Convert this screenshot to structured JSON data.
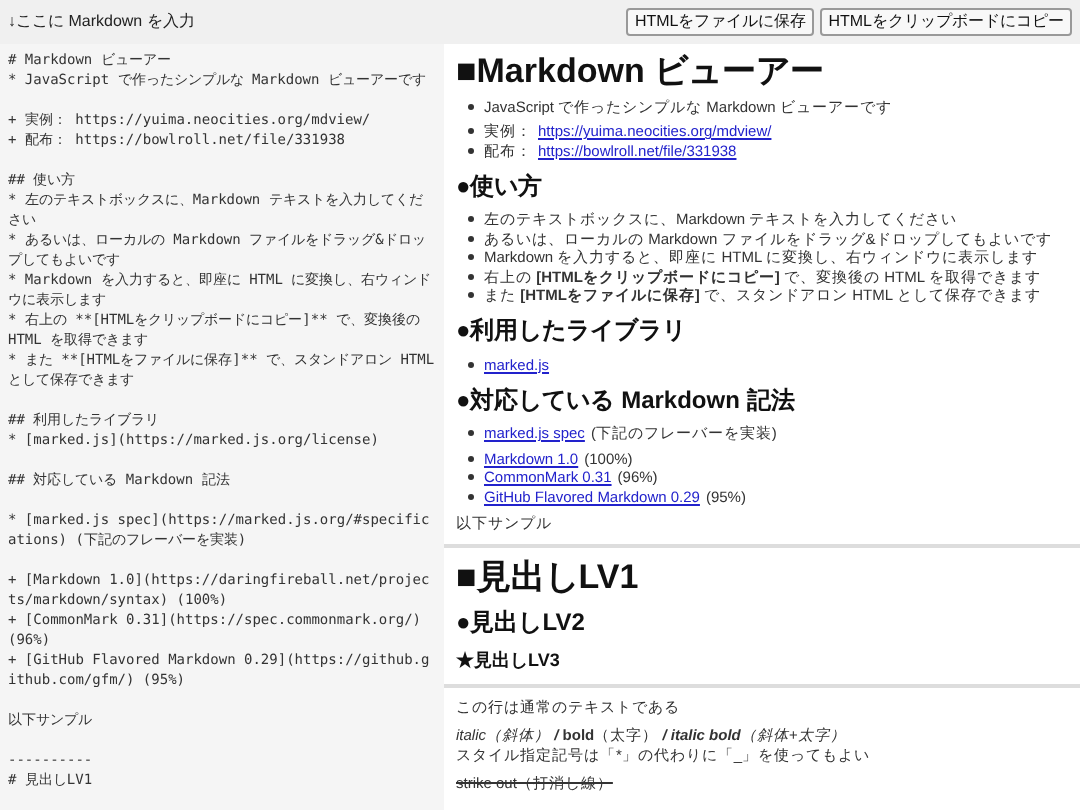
{
  "toolbar": {
    "label": "↓ここに Markdown を入力",
    "buttons": [
      "HTMLをファイルに保存",
      "HTMLをクリップボードにコピー"
    ]
  },
  "editor": {
    "blocks": [
      [
        "# Markdown ビューアー",
        "* JavaScript で作ったシンプルな Markdown ビューアーです"
      ],
      [
        "+ 実例： https://yuima.neocities.org/mdview/",
        "+ 配布： https://bowlroll.net/file/331938"
      ],
      [
        "## 使い方",
        "* 左のテキストボックスに、Markdown テキストを入力してください",
        "* あるいは、ローカルの Markdown ファイルをドラッグ&ドロップしてもよいです",
        "* Markdown を入力すると、即座に HTML に変換し、右ウィンドウに表示します",
        "* 右上の **[HTMLをクリップボードにコピー]** で、変換後の HTML を取得できます",
        "* また **[HTMLをファイルに保存]** で、スタンドアロン HTML として保存できます"
      ],
      [
        "## 利用したライブラリ",
        "* [marked.js](https://marked.js.org/license)"
      ],
      [
        "## 対応している Markdown 記法"
      ],
      [
        "* [marked.js spec](https://marked.js.org/#specifications) (下記のフレーバーを実装)"
      ],
      [
        "+ [Markdown 1.0](https://daringfireball.net/projects/markdown/syntax) (100%)",
        "+ [CommonMark 0.31](https://spec.commonmark.org/) (96%)",
        "+ [GitHub Flavored Markdown 0.29](https://github.github.com/gfm/) (95%)"
      ],
      [
        "以下サンプル"
      ],
      [
        "----------",
        "# 見出しLV1"
      ]
    ]
  },
  "preview": [
    {
      "kind": "h1",
      "text": "■Markdown ビューアー"
    },
    {
      "kind": "ul",
      "items": [
        {
          "text": "JavaScript で作ったシンプルな Markdown ビューアーです"
        }
      ]
    },
    {
      "kind": "ul",
      "items": [
        {
          "text": "実例：",
          "link": "https://yuima.neocities.org/mdview/"
        },
        {
          "text": "配布：",
          "link": "https://bowlroll.net/file/331938"
        }
      ]
    },
    {
      "kind": "h2",
      "text": "●使い方"
    },
    {
      "kind": "ul",
      "items": [
        {
          "text": "左のテキストボックスに、Markdown テキストを入力してください"
        },
        {
          "text": "あるいは、ローカルの Markdown ファイルをドラッグ&ドロップしてもよいです"
        },
        {
          "text": "Markdown を入力すると、即座に HTML に変換し、右ウィンドウに表示します"
        },
        {
          "text": "右上の **[HTMLをクリップボードにコピー]** で、変換後の HTML を取得できます"
        },
        {
          "text": "また **[HTMLをファイルに保存]** で、スタンドアロン HTML として保存できます"
        }
      ]
    },
    {
      "kind": "h2",
      "text": "●利用したライブラリ"
    },
    {
      "kind": "ul",
      "items": [
        {
          "link": "marked.js"
        }
      ]
    },
    {
      "kind": "h2",
      "text": "●対応している Markdown 記法"
    },
    {
      "kind": "ul",
      "items": [
        {
          "link": "marked.js spec",
          "suffix": "(下記のフレーバーを実装)"
        }
      ]
    },
    {
      "kind": "ul",
      "items": [
        {
          "link": "Markdown 1.0",
          "suffix": "(100%)"
        },
        {
          "link": "CommonMark 0.31",
          "suffix": "(96%)"
        },
        {
          "link": "GitHub Flavored Markdown 0.29",
          "suffix": "(95%)"
        }
      ]
    },
    {
      "kind": "p",
      "text": "以下サンプル"
    },
    {
      "kind": "hr"
    },
    {
      "kind": "h1",
      "text": "■見出しLV1"
    },
    {
      "kind": "h2",
      "text": "●見出しLV2"
    },
    {
      "kind": "h3",
      "text": "★見出しLV3"
    },
    {
      "kind": "hr"
    },
    {
      "kind": "p",
      "text": "この行は通常のテキストである"
    },
    {
      "kind": "styled",
      "segments": [
        {
          "kind": "italic",
          "text": "italic（斜体）"
        },
        {
          "kind": "bolditalic",
          "text": " / "
        },
        {
          "kind": "bold",
          "text": "bold"
        },
        {
          "kind": "plain",
          "text": "（太字）"
        },
        {
          "kind": "bolditalic",
          "text": " / italic bold"
        },
        {
          "kind": "italic",
          "text": "（斜体+太字）"
        }
      ],
      "line2": "スタイル指定記号は「*」の代わりに「_」を使ってもよい"
    },
    {
      "kind": "strike",
      "text": "strike out（打消し線）"
    }
  ]
}
